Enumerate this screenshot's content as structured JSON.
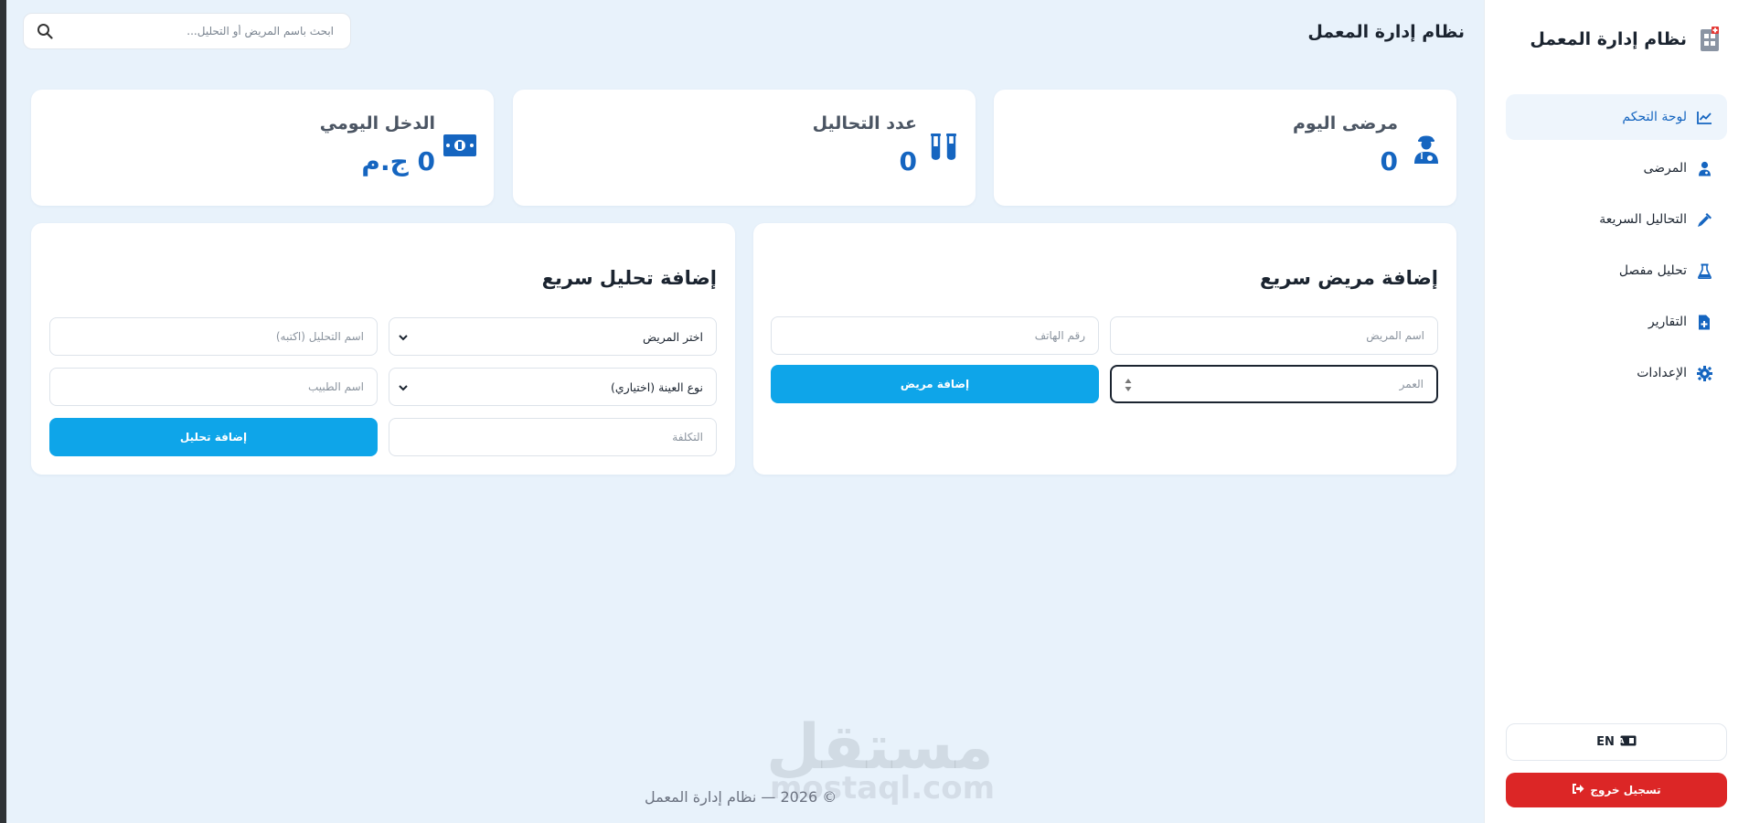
{
  "sidebar": {
    "brand_title": "نظام إدارة المعمل",
    "items": [
      {
        "label": "لوحة التحكم",
        "icon": "chart-line-icon",
        "active": true
      },
      {
        "label": "المرضى",
        "icon": "user-doctor-icon"
      },
      {
        "label": "التحاليل السريعة",
        "icon": "syringe-icon"
      },
      {
        "label": "تحليل مفصل",
        "icon": "flask-icon"
      },
      {
        "label": "التقارير",
        "icon": "file-medical-icon"
      },
      {
        "label": "الإعدادات",
        "icon": "gear-icon"
      }
    ],
    "language_label": "EN",
    "logout_label": "تسجيل خروج"
  },
  "header": {
    "title": "نظام إدارة المعمل",
    "search_placeholder": "ابحث باسم المريض أو التحليل..."
  },
  "stats": {
    "today_patients": {
      "label": "مرضى اليوم",
      "value": "0",
      "icon": "patient-icon"
    },
    "tests_count": {
      "label": "عدد التحاليل",
      "value": "0",
      "icon": "test-tubes-icon"
    },
    "daily_income": {
      "label": "الدخل اليومي",
      "value": "0 ج.م",
      "icon": "money-icon"
    }
  },
  "quick_patient": {
    "title": "إضافة مريض سريع",
    "name_placeholder": "اسم المريض",
    "phone_placeholder": "رقم الهاتف",
    "age_placeholder": "العمر",
    "submit_label": "إضافة مريض"
  },
  "quick_test": {
    "title": "إضافة تحليل سريع",
    "patient_select": "اختر المريض",
    "test_name_placeholder": "اسم التحليل (اكتبه)",
    "sample_type_select": "نوع العينة (اختياري)",
    "doctor_placeholder": "اسم الطبيب",
    "cost_placeholder": "التكلفة",
    "submit_label": "إضافة تحليل"
  },
  "footer": {
    "text": "© 2026 — نظام إدارة المعمل"
  },
  "watermark": {
    "text": "مستقل",
    "sub": "mostaql.com"
  },
  "colors": {
    "accent": "#0ea5e9",
    "primary": "#1565c0",
    "danger": "#dc2626",
    "background": "#e8f2fb"
  }
}
